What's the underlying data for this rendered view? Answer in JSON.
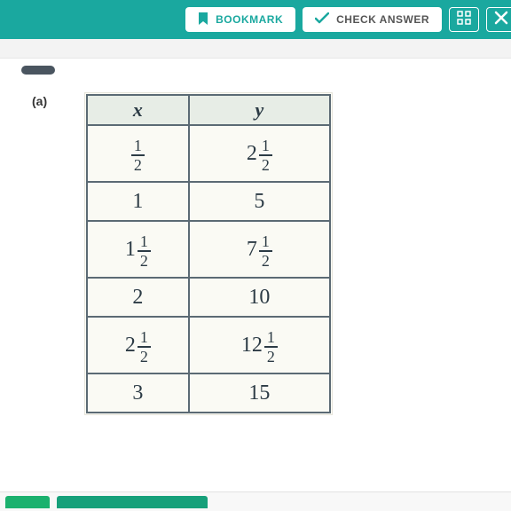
{
  "toolbar": {
    "bookmark_label": "BOOKMARK",
    "check_label": "CHECK ANSWER"
  },
  "question": {
    "part_label": "(a)"
  },
  "chart_data": {
    "type": "table",
    "title": "",
    "columns": [
      "x",
      "y"
    ],
    "rows": [
      {
        "x": "1/2",
        "y": "2 1/2"
      },
      {
        "x": "1",
        "y": "5"
      },
      {
        "x": "1 1/2",
        "y": "7 1/2"
      },
      {
        "x": "2",
        "y": "10"
      },
      {
        "x": "2 1/2",
        "y": "12 1/2"
      },
      {
        "x": "3",
        "y": "15"
      }
    ]
  },
  "t": {
    "hx": "x",
    "hy": "y",
    "r0x_n": "1",
    "r0x_d": "2",
    "r0y_w": "2",
    "r0y_n": "1",
    "r0y_d": "2",
    "r1x": "1",
    "r1y": "5",
    "r2x_w": "1",
    "r2x_n": "1",
    "r2x_d": "2",
    "r2y_w": "7",
    "r2y_n": "1",
    "r2y_d": "2",
    "r3x": "2",
    "r3y": "10",
    "r4x_w": "2",
    "r4x_n": "1",
    "r4x_d": "2",
    "r4y_w": "12",
    "r4y_n": "1",
    "r4y_d": "2",
    "r5x": "3",
    "r5y": "15"
  }
}
